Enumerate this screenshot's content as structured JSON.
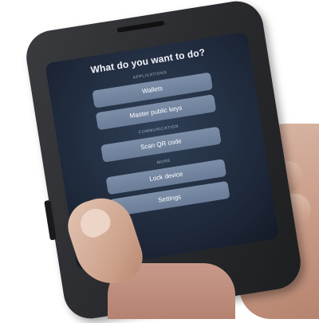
{
  "screen": {
    "title": "What do you want to do?",
    "sections": [
      {
        "label": "APPLICATIONS",
        "buttons": [
          "Wallets",
          "Master public keys"
        ]
      },
      {
        "label": "COMMUNICATION",
        "buttons": [
          "Scan QR code"
        ]
      },
      {
        "label": "MORE",
        "buttons": [
          "Lock device",
          "Settings"
        ]
      }
    ]
  },
  "colors": {
    "screen_background": "#1d2738",
    "button": "#6a7c97",
    "device_body": "#2a2b2e",
    "skin": "#c89a86"
  }
}
